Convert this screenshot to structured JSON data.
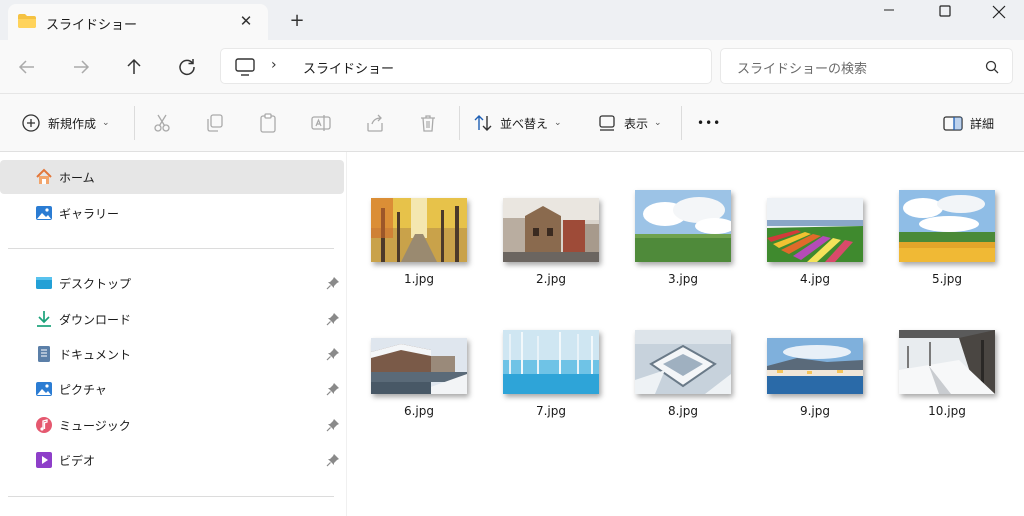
{
  "window": {
    "tab_title": "スライドショー",
    "tab_close": "✕",
    "new_tab": "+"
  },
  "addressbar": {
    "path": "スライドショー",
    "separator": "›",
    "search_placeholder": "スライドショーの検索"
  },
  "commandbar": {
    "new_label": "新規作成",
    "sort_label": "並べ替え",
    "view_label": "表示",
    "more_label": "•••",
    "details_label": "詳細"
  },
  "sidebar": {
    "top_items": [
      {
        "label": "ホーム",
        "icon": "home-icon"
      },
      {
        "label": "ギャラリー",
        "icon": "gallery-icon"
      }
    ],
    "pinned_items": [
      {
        "label": "デスクトップ",
        "icon": "desktop-icon"
      },
      {
        "label": "ダウンロード",
        "icon": "download-icon"
      },
      {
        "label": "ドキュメント",
        "icon": "documents-icon"
      },
      {
        "label": "ピクチャ",
        "icon": "pictures-icon"
      },
      {
        "label": "ミュージック",
        "icon": "music-icon"
      },
      {
        "label": "ビデオ",
        "icon": "videos-icon"
      }
    ]
  },
  "files": [
    {
      "name": "1.jpg",
      "scene": "autumn-trees"
    },
    {
      "name": "2.jpg",
      "scene": "old-building"
    },
    {
      "name": "3.jpg",
      "scene": "green-field-clouds"
    },
    {
      "name": "4.jpg",
      "scene": "flower-stripes"
    },
    {
      "name": "5.jpg",
      "scene": "sunflower-field"
    },
    {
      "name": "6.jpg",
      "scene": "snowy-canal"
    },
    {
      "name": "7.jpg",
      "scene": "blue-pond"
    },
    {
      "name": "8.jpg",
      "scene": "snow-fort"
    },
    {
      "name": "9.jpg",
      "scene": "night-city-bay"
    },
    {
      "name": "10.jpg",
      "scene": "snowy-station"
    }
  ]
}
